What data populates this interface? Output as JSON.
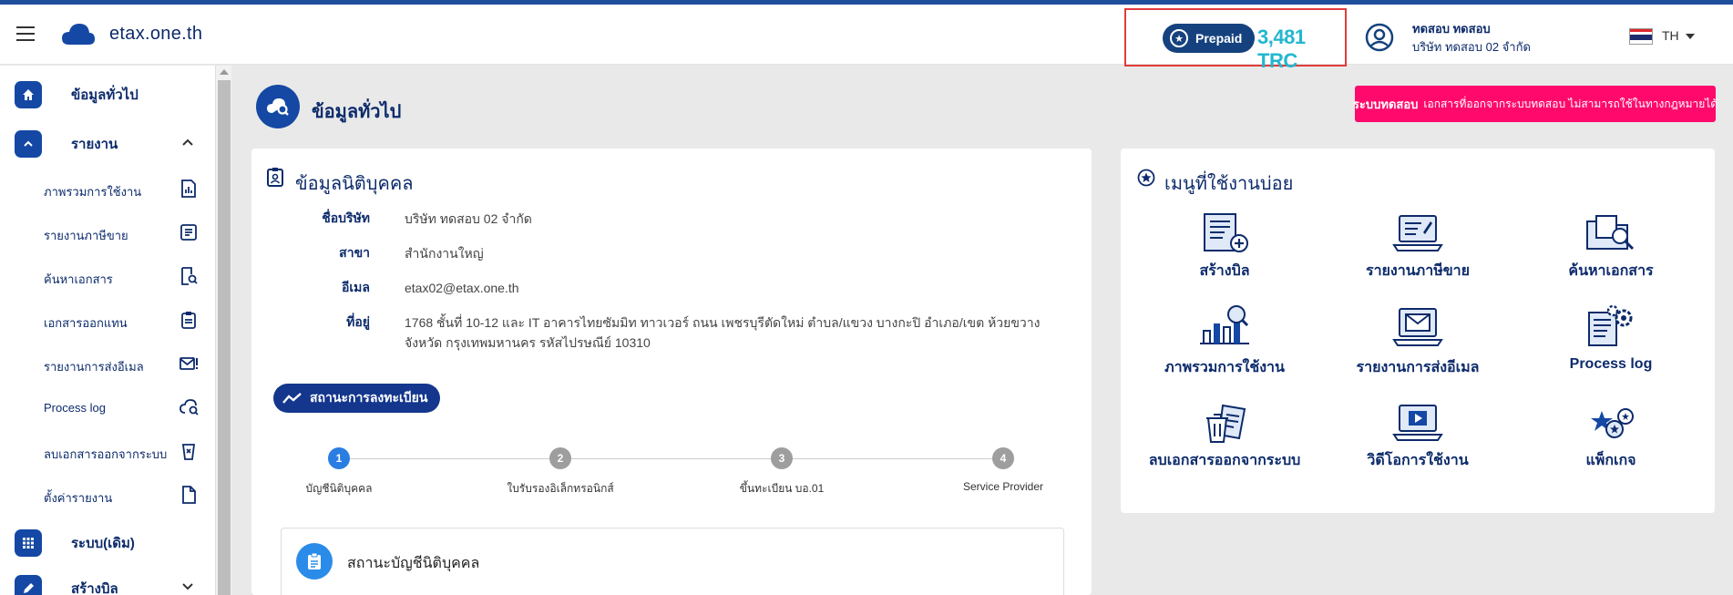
{
  "header": {
    "brand": "etax.one.th",
    "prepaid_label": "Prepaid",
    "credit": "3,481 TRC",
    "user_name": "ทดสอบ ทดสอบ",
    "user_company": "บริษัท ทดสอบ 02 จำกัด",
    "lang": "TH"
  },
  "sidebar": {
    "general": "ข้อมูลทั่วไป",
    "report": "รายงาน",
    "sub_items": [
      "ภาพรวมการใช้งาน",
      "รายงานภาษีขาย",
      "ค้นหาเอกสาร",
      "เอกสารออกแทน",
      "รายงานการส่งอีเมล",
      "Process log",
      "ลบเอกสารออกจากระบบ",
      "ตั้งค่ารายงาน"
    ],
    "legacy": "ระบบ(เดิม)",
    "create_bill": "สร้างบิล"
  },
  "page": {
    "title": "ข้อมูลทั่วไป",
    "banner_bold": "ระบบทดสอบ",
    "banner_text": "เอกสารที่ออกจากระบบทดสอบ ไม่สามารถใช้ในทางกฎหมายได้"
  },
  "company": {
    "title": "ข้อมูลนิติบุคคล",
    "labels": {
      "name": "ชื่อบริษัท",
      "branch": "สาขา",
      "email": "อีเมล",
      "address": "ที่อยู่"
    },
    "values": {
      "name": "บริษัท ทดสอบ 02 จำกัด",
      "branch": "สำนักงานใหญ่",
      "email": "etax02@etax.one.th",
      "address_line1": "1768 ชั้นที่ 10-12 และ IT อาคารไทยซัมมิท ทาวเวอร์ ถนน เพชรบุรีตัดใหม่ ตำบล/แขวง บางกะปิ อำเภอ/เขต ห้วยขวาง",
      "address_line2": "จังหวัด กรุงเทพมหานคร รหัสไปรษณีย์ 10310"
    },
    "status_button": "สถานะการลงทะเบียน",
    "steps": [
      {
        "num": "1",
        "label": "บัญชีนิติบุคคล"
      },
      {
        "num": "2",
        "label": "ใบรับรองอิเล็กทรอนิกส์"
      },
      {
        "num": "3",
        "label": "ขึ้นทะเบียน บอ.01"
      },
      {
        "num": "4",
        "label": "Service Provider"
      }
    ],
    "status_box_title": "สถานะบัญชีนิติบุคคล"
  },
  "frequent": {
    "title": "เมนูที่ใช้งานบ่อย",
    "items": [
      "สร้างบิล",
      "รายงานภาษีขาย",
      "ค้นหาเอกสาร",
      "ภาพรวมการใช้งาน",
      "รายงานการส่งอีเมล",
      "Process log",
      "ลบเอกสารออกจากระบบ",
      "วิดีโอการใช้งาน",
      "แพ็กเกจ"
    ]
  },
  "colors": {
    "navy": "#0d2b6b",
    "primary": "#1448a4",
    "accent_cyan": "#22b7cf",
    "banner": "#ff0a6c",
    "step_active": "#2a7de1",
    "step_inactive": "#9e9e9e"
  }
}
